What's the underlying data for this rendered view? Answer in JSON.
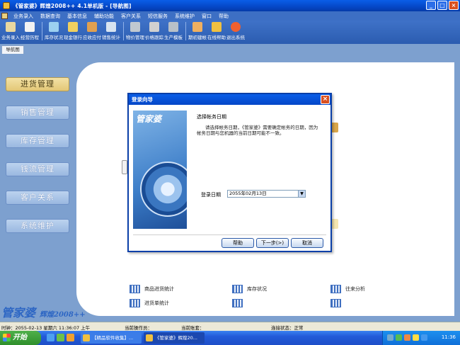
{
  "window": {
    "title": "《管家婆》辉煌2008++ 4.1单机版 - [导航图]",
    "buttons": {
      "minimize": "_",
      "maximize": "□",
      "close": "×"
    }
  },
  "menu": [
    "业务录入",
    "数据查询",
    "基本信息",
    "辅助功能",
    "客户关系",
    "短信服务",
    "系统维护",
    "窗口",
    "帮助"
  ],
  "toolbar": [
    {
      "label": "业务录入",
      "icon": "edit-icon",
      "color": "#e9d8a0"
    },
    {
      "label": "经营历程",
      "icon": "document-icon",
      "color": "#f2f2f2"
    },
    {
      "label": "库存状况",
      "icon": "arrows-icon",
      "color": "#9cd0f0"
    },
    {
      "label": "现金银行",
      "icon": "coins-icon",
      "color": "#f0d060"
    },
    {
      "label": "应收应付",
      "icon": "card-icon",
      "color": "#e0a050"
    },
    {
      "label": "销售统计",
      "icon": "chart-icon",
      "color": "#d8e4f0"
    },
    {
      "label": "物价管理",
      "icon": "price-icon",
      "color": "#c0c8d0"
    },
    {
      "label": "价格跟踪",
      "icon": "tag-icon",
      "color": "#d0d0d0"
    },
    {
      "label": "生产模板",
      "icon": "gear-icon",
      "color": "#b8c0c8"
    },
    {
      "label": "期初建帐",
      "icon": "open-book-icon",
      "color": "#f0b060"
    },
    {
      "label": "在线帮助",
      "icon": "help-icon",
      "color": "#f0c040"
    },
    {
      "label": "退出系统",
      "icon": "exit-icon",
      "color": "#f06030"
    }
  ],
  "tab": "导航图",
  "nav": [
    "进货管理",
    "销售管理",
    "库存管理",
    "钱流管理",
    "客户关系",
    "系统维护"
  ],
  "bottom_links": [
    "商品进货统计",
    "库存状况",
    "往来分析",
    "进货单统计"
  ],
  "brand": {
    "name": "管家婆",
    "sub": "辉煌2008++"
  },
  "dialog": {
    "title": "登录向导",
    "close": "×",
    "logo": "管家婆",
    "heading": "选择帐务日期",
    "text": "请选择帐务日期，《管家婆》需要确定帐务的日期，因为帐务日期与您机器的当前日期可能不一致。",
    "date_label": "登录日期",
    "date_value": "2055年02月13日",
    "buttons": {
      "help": "帮助",
      "next": "下一步(>)",
      "cancel": "取消"
    }
  },
  "status": {
    "time": "时钟：2055-02-13 星期六 11:36:07 上午",
    "operator": "当前操作员：",
    "account": "当前账套：",
    "connection": "连接状态：正常"
  },
  "taskbar": {
    "start": "开始",
    "tasks": [
      "【精品软件收集】...",
      "《管家婆》辉煌20..."
    ],
    "clock": "11:36"
  },
  "colors": {
    "accent": "#0a5ee8",
    "nav_active": "#e3c776",
    "panel_bg": "#7da0cf"
  }
}
